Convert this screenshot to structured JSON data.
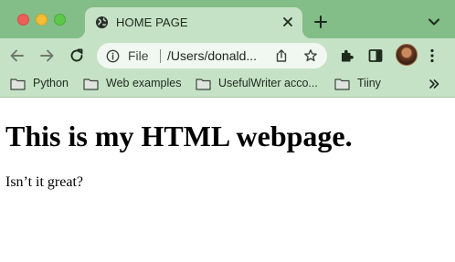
{
  "tab": {
    "title": "HOME PAGE",
    "favicon": "globe-icon"
  },
  "toolbar": {
    "back": "back-arrow-icon",
    "forward": "forward-arrow-icon",
    "reload": "reload-icon",
    "omnibox": {
      "scheme_label": "File",
      "url": "/Users/donald..."
    },
    "menu": "more-vertical-icon"
  },
  "bookmarks": [
    {
      "label": "Python"
    },
    {
      "label": "Web examples"
    },
    {
      "label": "UsefulWriter acco..."
    },
    {
      "label": "Tiiny"
    }
  ],
  "page": {
    "heading": "This is my HTML webpage.",
    "paragraph": "Isn’t it great?"
  },
  "colors": {
    "titlebar": "#83bd87",
    "toolbar": "#c6e2c6",
    "omnibox": "#f1f7f1",
    "content": "#ffffff"
  }
}
